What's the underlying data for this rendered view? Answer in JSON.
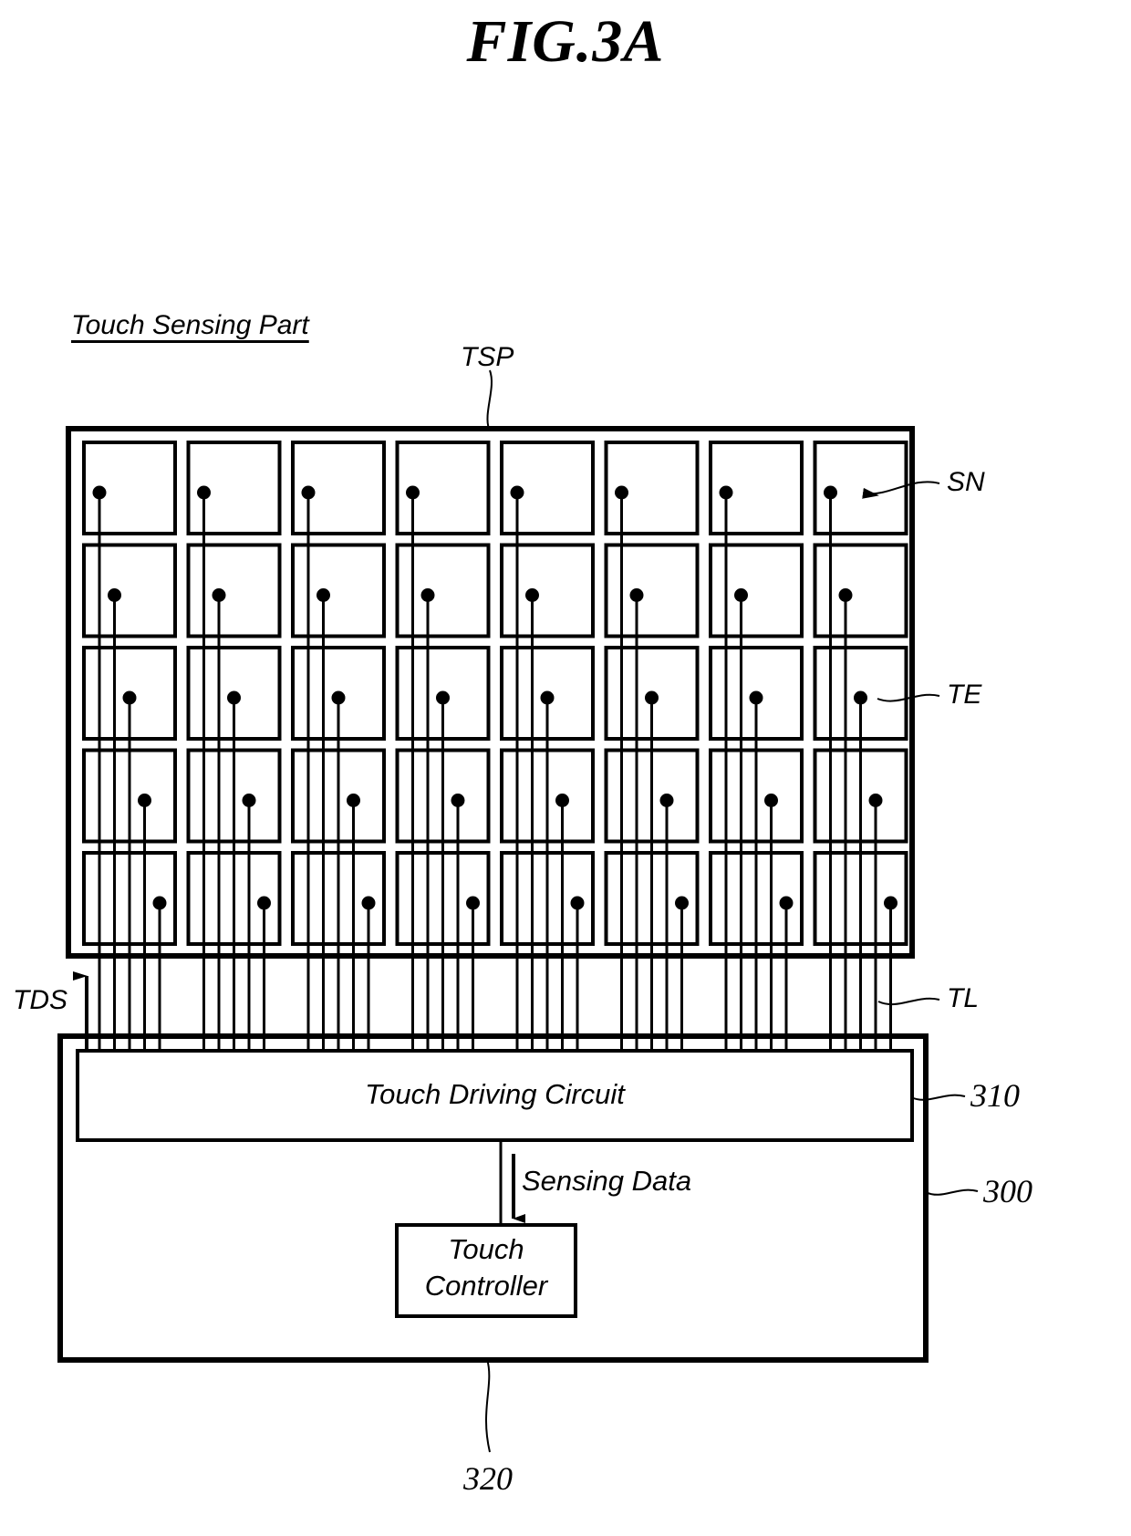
{
  "figure": {
    "title": "FIG.3A",
    "type": "patent-diagram",
    "section_heading": "Touch Sensing Part"
  },
  "reference_labels": {
    "tsp": "TSP",
    "sn": "SN",
    "te": "TE",
    "tl": "TL",
    "tds": "TDS",
    "num_310": "310",
    "num_300": "300",
    "num_320": "320"
  },
  "blocks": {
    "touch_driving_circuit": "Touch Driving Circuit",
    "touch_controller_line1": "Touch",
    "touch_controller_line2": "Controller"
  },
  "signals": {
    "sensing_data": "Sensing Data"
  },
  "grid": {
    "columns": 8,
    "rows": 5,
    "electrode_label": "TE",
    "node_label": "SN",
    "line_label": "TL"
  },
  "colors": {
    "stroke": "#000000",
    "background": "#ffffff"
  }
}
